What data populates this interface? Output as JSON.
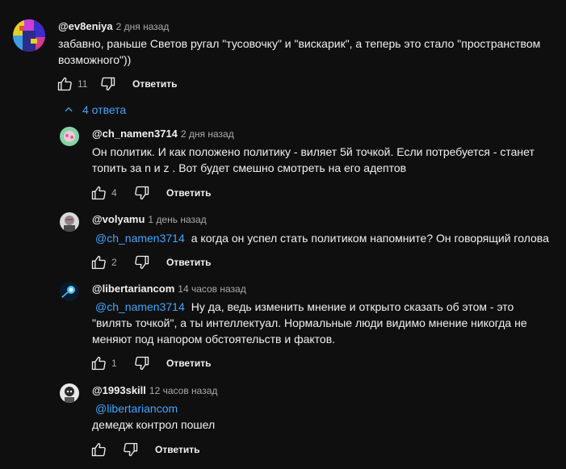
{
  "comment": {
    "author": "@ev8eniya",
    "time": "2 дня назад",
    "text": "забавно, раньше Светов ругал \"тусовочку\" и \"вискарик\", а теперь это стало \"пространством возможного\"))",
    "likes": "11",
    "reply_label": "Ответить"
  },
  "replies_toggle": {
    "label": "4 ответа"
  },
  "replies": [
    {
      "author": "@ch_namen3714",
      "time": "2 дня назад",
      "mention": "",
      "text": "Он политик. И как положено политику - виляет 5й точкой. Если потребуется - станет топить за n и z . Вот будет смешно смотреть на его адептов",
      "likes": "4",
      "reply_label": "Ответить"
    },
    {
      "author": "@volyamu",
      "time": "1 день назад",
      "mention": "@ch_namen3714",
      "text": "а когда он успел стать политиком напомните? Он говорящий голова",
      "likes": "2",
      "reply_label": "Ответить"
    },
    {
      "author": "@libertariancom",
      "time": "14 часов назад",
      "mention": "@ch_namen3714",
      "text": "Ну да, ведь изменить мнение и открыто сказать об этом - это \"вилять точкой\", а ты интеллектуал. Нормальные люди видимо мнение никогда не меняют под напором обстоятельств и фактов.",
      "likes": "1",
      "reply_label": "Ответить"
    },
    {
      "author": "@1993skill",
      "time": "12 часов назад",
      "mention": "@libertariancom",
      "text": "демедж контрол пошел",
      "likes": "",
      "reply_label": "Ответить"
    }
  ],
  "icons": {
    "like": "thumbs-up-icon",
    "dislike": "thumbs-down-icon",
    "toggle": "chevron-up-icon"
  },
  "colors": {
    "background": "#0f0f0f",
    "text": "#f1f1f1",
    "secondary": "#aaaaaa",
    "link": "#3ea6ff"
  }
}
